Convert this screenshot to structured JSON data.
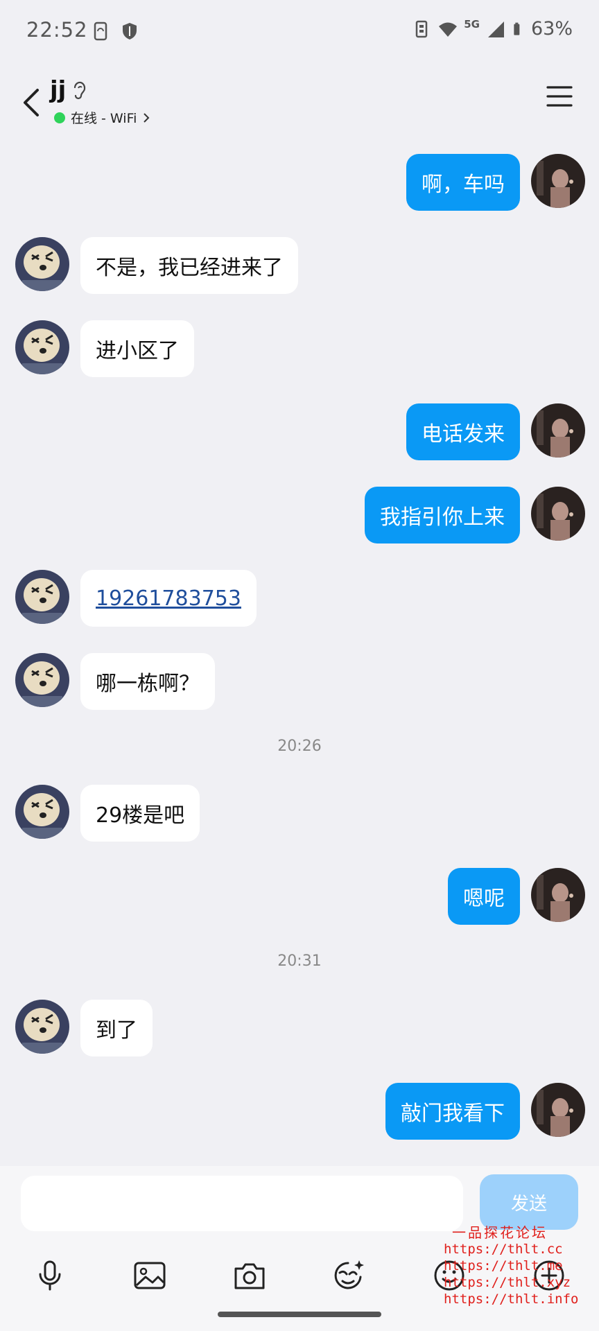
{
  "status_bar": {
    "time": "22:52",
    "network": "5G",
    "battery": "63%"
  },
  "header": {
    "contact_name": "jj",
    "online_status": "在线 - WiFi"
  },
  "messages": [
    {
      "side": "out",
      "text": "啊，车吗"
    },
    {
      "side": "in",
      "text": "不是，我已经进来了"
    },
    {
      "side": "in",
      "text": "进小区了"
    },
    {
      "side": "out",
      "text": "电话发来"
    },
    {
      "side": "out",
      "text": "我指引你上来"
    },
    {
      "side": "in",
      "text": "19261783753"
    },
    {
      "side": "in",
      "text": "哪一栋啊？"
    },
    {
      "side": "in",
      "text": "29楼是吧"
    },
    {
      "side": "out",
      "text": "嗯呢"
    },
    {
      "side": "in",
      "text": "到了"
    },
    {
      "side": "out",
      "text": "敲门我看下"
    }
  ],
  "timestamps": [
    "20:26",
    "20:31"
  ],
  "input": {
    "placeholder": "",
    "send_label": "发送"
  },
  "toolbar_icons": [
    "microphone-icon",
    "image-icon",
    "camera-icon",
    "sticker-icon",
    "emoji-icon",
    "plus-icon"
  ],
  "watermark": {
    "title": "一品探花论坛",
    "lines": [
      "https://thlt.cc",
      "https://thlt.me",
      "https://thlt.xyz",
      "https://thlt.info"
    ]
  },
  "colors": {
    "outgoing_bubble": "#0a99f5",
    "incoming_bubble": "#ffffff",
    "online_dot": "#2fd35a",
    "send_button": "#9dd1fb",
    "watermark": "#e0201c"
  }
}
